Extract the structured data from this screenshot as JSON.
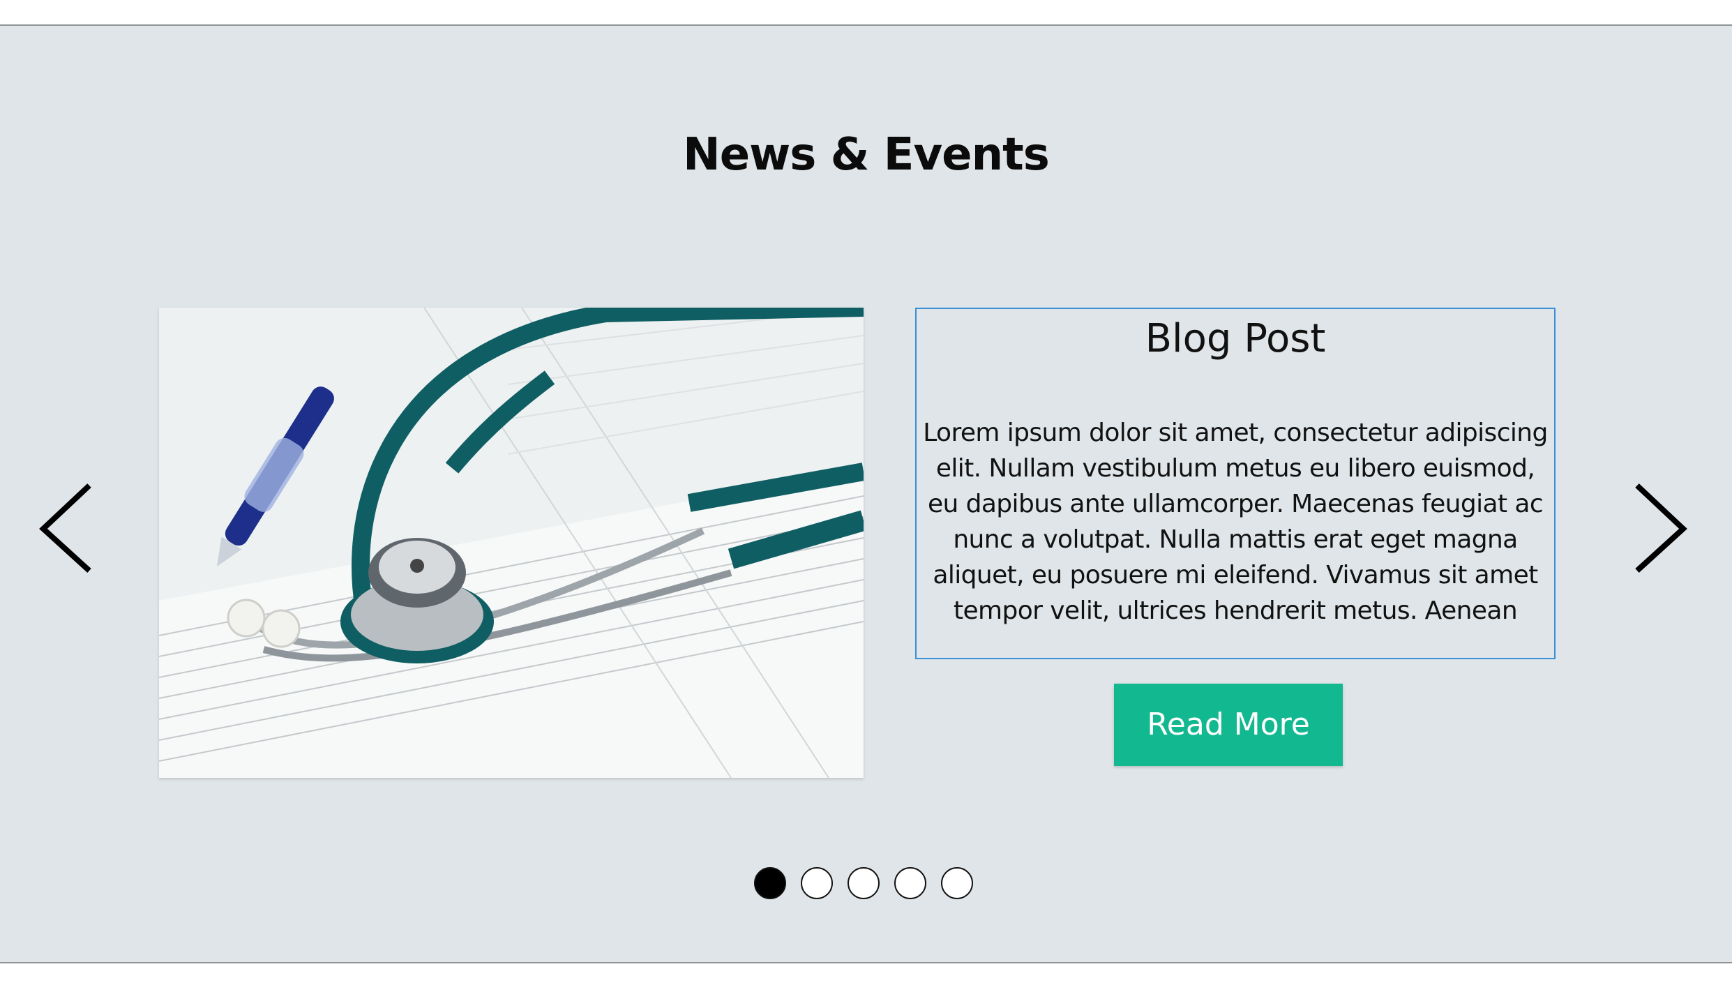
{
  "section": {
    "title": "News & Events"
  },
  "post": {
    "title": "Blog Post",
    "text": "Lorem ipsum dolor sit amet, consectetur adipiscing elit. Nullam vestibulum metus eu libero euismod, eu dapibus ante ullamcorper. Maecenas feugiat ac nunc a volutpat. Nulla mattis erat eget magna aliquet, eu posuere mi eleifend. Vivamus sit amet tempor velit, ultrices hendrerit metus. Aenean",
    "read_more_label": "Read More",
    "image_icon": "stethoscope-photo"
  },
  "carousel": {
    "prev_icon": "chevron-left-icon",
    "next_icon": "chevron-right-icon",
    "slide_count": 5,
    "active_index": 0
  },
  "colors": {
    "section_background": "#dfe5e8",
    "button_background": "#12b88f",
    "box_border": "#3a8fd6",
    "dot_active": "#000000"
  }
}
